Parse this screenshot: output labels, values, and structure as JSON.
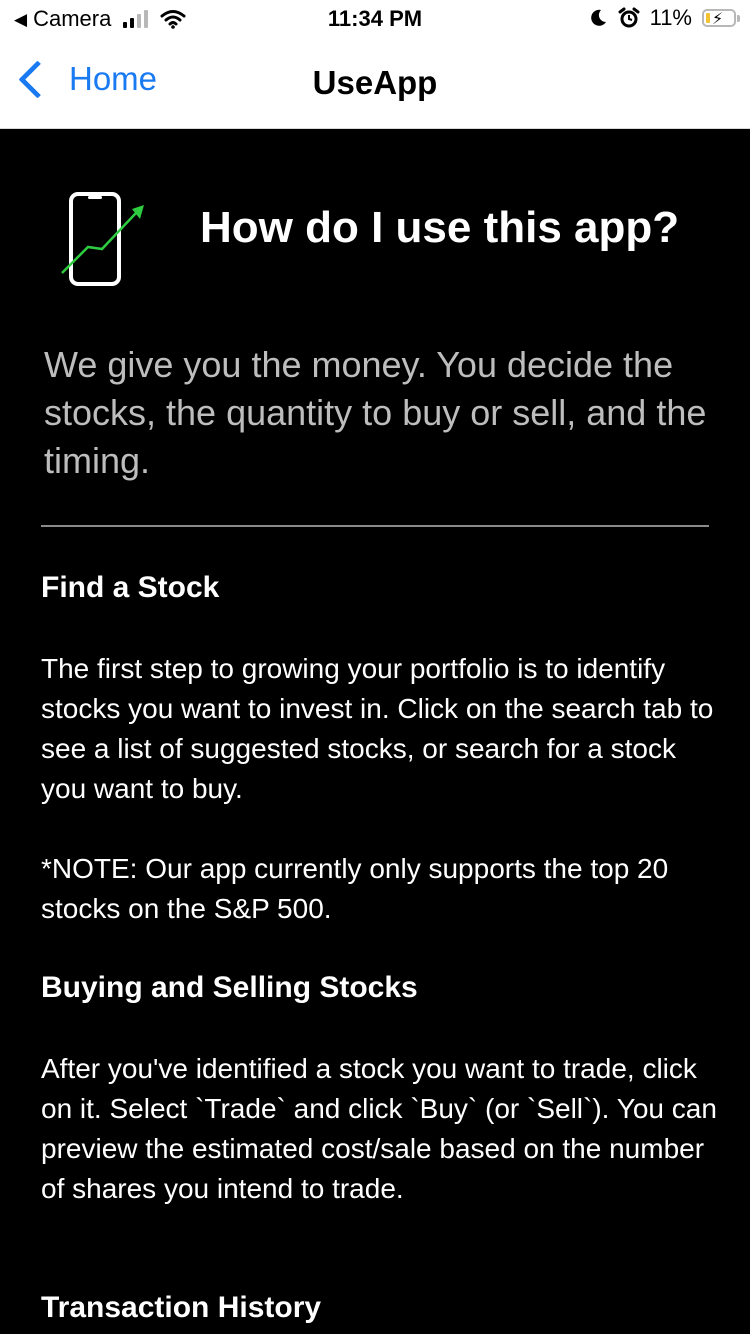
{
  "status_bar": {
    "back_app": "Camera",
    "time": "11:34 PM",
    "battery_percent": "11%"
  },
  "nav": {
    "back_label": "Home",
    "title": "UseApp"
  },
  "hero": {
    "title": "How do I use this app?"
  },
  "intro": "We give you the money. You decide the stocks, the quantity to buy or sell, and the timing.",
  "sections": [
    {
      "heading": "Find a Stock",
      "paragraphs": [
        "The first step to growing your portfolio is to identify stocks you want to invest in. Click on the search tab to see a list of suggested stocks, or search for a stock you want to buy.",
        "*NOTE: Our app currently only supports the top 20 stocks on the S&P 500."
      ]
    },
    {
      "heading": "Buying and Selling Stocks",
      "paragraphs": [
        "After you've identified a stock you want to trade, click on it. Select `Trade` and click `Buy` (or `Sell`). You can preview the estimated cost/sale based on the number of shares you intend to trade."
      ]
    },
    {
      "heading": "Transaction History",
      "paragraphs": []
    }
  ],
  "colors": {
    "accent": "#1a7af2",
    "background": "#000000",
    "intro_text": "#bdbdbd",
    "arrow_green": "#2ecc40"
  }
}
